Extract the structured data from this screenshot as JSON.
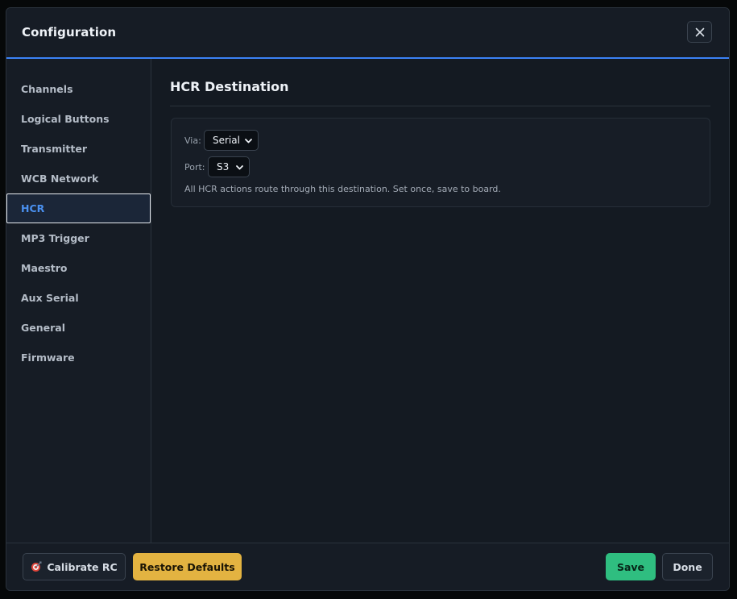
{
  "dialog": {
    "title": "Configuration",
    "close_icon": "close-icon"
  },
  "sidebar": {
    "items": [
      {
        "label": "Channels"
      },
      {
        "label": "Logical Buttons"
      },
      {
        "label": "Transmitter"
      },
      {
        "label": "WCB Network"
      },
      {
        "label": "HCR",
        "active": true
      },
      {
        "label": "MP3 Trigger"
      },
      {
        "label": "Maestro"
      },
      {
        "label": "Aux Serial"
      },
      {
        "label": "General"
      },
      {
        "label": "Firmware"
      }
    ]
  },
  "main": {
    "section_title": "HCR Destination",
    "via": {
      "label": "Via:",
      "value": "Serial"
    },
    "port": {
      "label": "Port:",
      "value": "S3"
    },
    "help_text": "All HCR actions route through this destination. Set once, save to board."
  },
  "footer": {
    "calibrate_label": "Calibrate RC",
    "calibrate_icon": "target-icon",
    "restore_label": "Restore Defaults",
    "save_label": "Save",
    "done_label": "Done"
  },
  "colors": {
    "accent": "#3b82f6",
    "save": "#2fbe80",
    "restore": "#e3b341",
    "background": "#141a22"
  }
}
